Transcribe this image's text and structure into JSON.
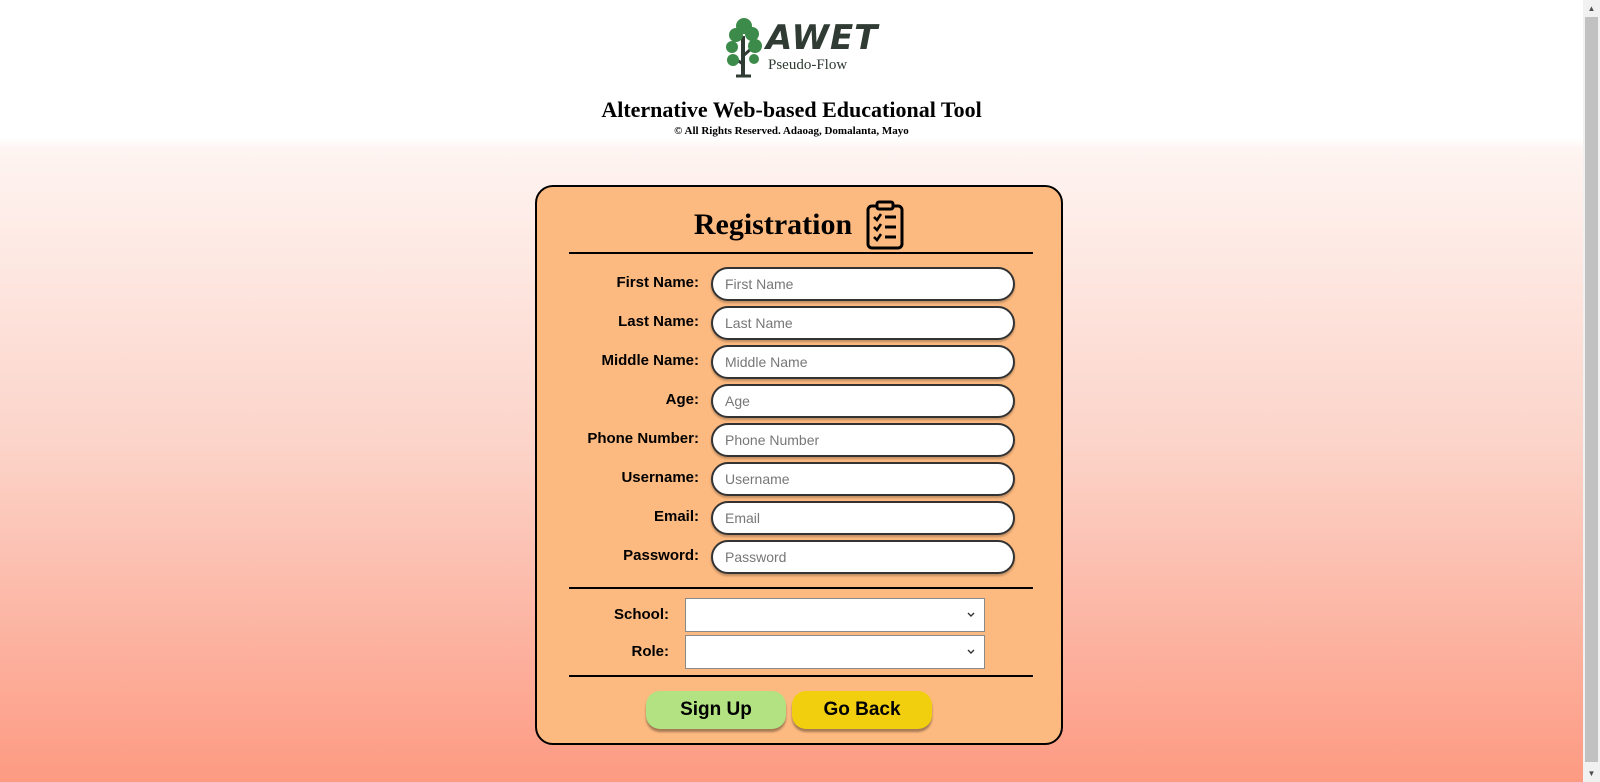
{
  "header": {
    "logo_word": "AWET",
    "logo_subtitle": "Pseudo-Flow",
    "title": "Alternative Web-based Educational Tool",
    "copyright": "© All Rights Reserved. Adaoag, Domalanta, Mayo"
  },
  "form": {
    "heading": "Registration",
    "heading_icon": "clipboard-checklist-icon",
    "fields": [
      {
        "label": "First Name:",
        "placeholder": "First Name",
        "value": ""
      },
      {
        "label": "Last Name:",
        "placeholder": "Last Name",
        "value": ""
      },
      {
        "label": "Middle Name:",
        "placeholder": "Middle Name",
        "value": ""
      },
      {
        "label": "Age:",
        "placeholder": "Age",
        "value": ""
      },
      {
        "label": "Phone Number:",
        "placeholder": "Phone Number",
        "value": ""
      },
      {
        "label": "Username:",
        "placeholder": "Username",
        "value": ""
      },
      {
        "label": "Email:",
        "placeholder": "Email",
        "value": ""
      },
      {
        "label": "Password:",
        "placeholder": "Password",
        "value": ""
      }
    ],
    "selects": [
      {
        "label": "School:",
        "selected": ""
      },
      {
        "label": "Role:",
        "selected": ""
      }
    ],
    "buttons": {
      "signup": "Sign Up",
      "back": "Go Back"
    }
  },
  "colors": {
    "card_background": "#fdba80",
    "signup_button": "#b2e282",
    "back_button": "#f2cf0e",
    "logo_green": "#3d8b4a"
  }
}
